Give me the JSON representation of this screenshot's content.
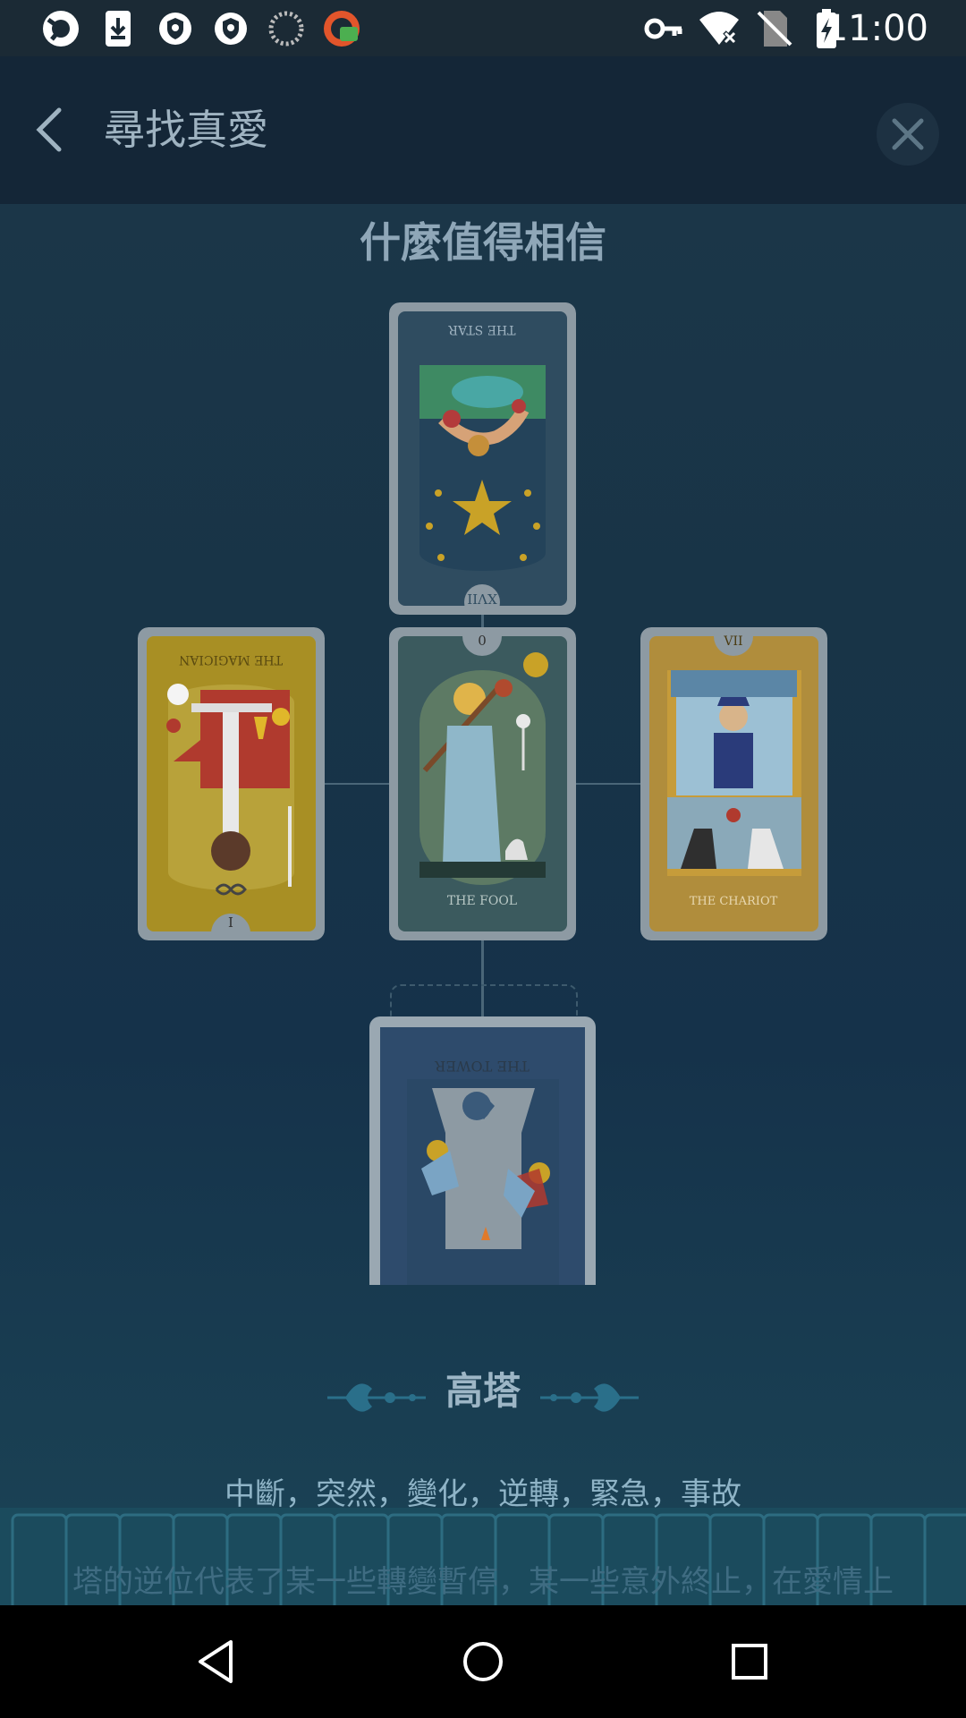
{
  "status_bar": {
    "time": "11:00",
    "left_icons": [
      "sync-app-icon",
      "download-icon",
      "vpn-shield-icon",
      "vpn-shield-icon",
      "loading-icon",
      "app-badge-icon"
    ],
    "right_icons": [
      "key-icon",
      "wifi-off-icon",
      "no-sim-icon",
      "battery-charging-icon"
    ]
  },
  "app_bar": {
    "title": "尋找真愛"
  },
  "spread": {
    "title": "什麼值得相信",
    "cards": [
      {
        "name": "THE STAR",
        "numeral": "XVII",
        "reversed": true
      },
      {
        "name": "THE MAGICIAN",
        "numeral": "I",
        "reversed": true
      },
      {
        "name": "THE FOOL",
        "numeral": "0",
        "reversed": false
      },
      {
        "name": "THE CHARIOT",
        "numeral": "VII",
        "reversed": false
      },
      {
        "name": "THE TOWER",
        "numeral": "",
        "reversed": true
      }
    ]
  },
  "selected_card": {
    "name": "高塔",
    "keywords": "中斷，突然，變化，逆轉，緊急，事故",
    "description": "塔的逆位代表了某一些轉變暫停，某一些意外終止，在愛情上"
  },
  "colors": {
    "status_bar": "#1b2a35",
    "app_bar": "#142637",
    "background": "#183447",
    "accent_ornament": "#2a6f8a"
  }
}
